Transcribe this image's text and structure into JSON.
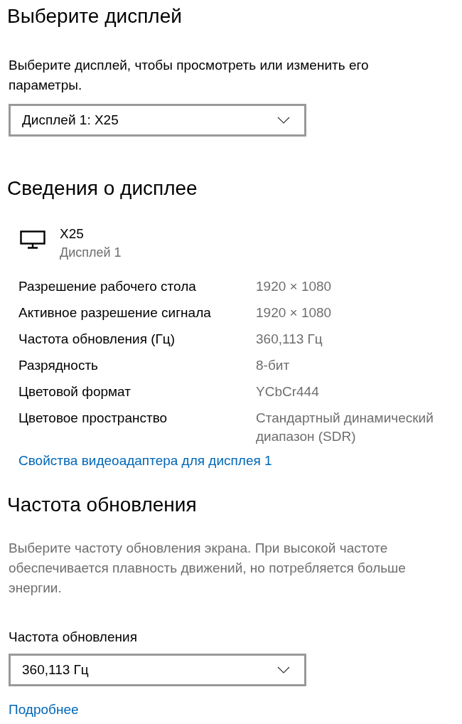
{
  "select_display": {
    "title": "Выберите дисплей",
    "description": "Выберите дисплей, чтобы просмотреть или изменить его параметры.",
    "dropdown": {
      "value": "Дисплей 1: X25"
    }
  },
  "display_info": {
    "title": "Сведения о дисплее",
    "monitor": {
      "name": "X25",
      "subtitle": "Дисплей 1"
    },
    "rows": [
      {
        "label": "Разрешение рабочего стола",
        "value": "1920 × 1080"
      },
      {
        "label": "Активное разрешение сигнала",
        "value": "1920 × 1080"
      },
      {
        "label": "Частота обновления (Гц)",
        "value": "360,113 Гц"
      },
      {
        "label": "Разрядность",
        "value": "8-бит"
      },
      {
        "label": "Цветовой формат",
        "value": "YCbCr444"
      },
      {
        "label": "Цветовое пространство",
        "value": "Стандартный динамический диапазон (SDR)"
      }
    ],
    "link": "Свойства видеоадаптера для дисплея 1"
  },
  "refresh_rate": {
    "title": "Частота обновления",
    "description": "Выберите частоту обновления экрана. При высокой частоте обеспечивается плавность движений, но потребляется больше энергии.",
    "field_label": "Частота обновления",
    "dropdown": {
      "value": "360,113 Гц"
    },
    "link": "Подробнее"
  }
}
